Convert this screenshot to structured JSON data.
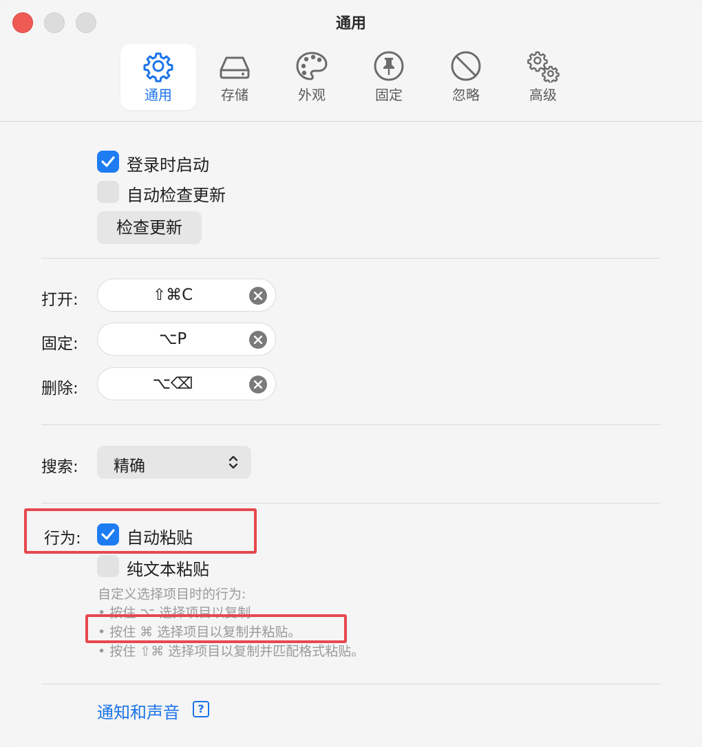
{
  "window": {
    "title": "通用"
  },
  "toolbar": {
    "tabs": [
      {
        "label": "通用",
        "icon": "gear-icon",
        "active": true
      },
      {
        "label": "存储",
        "icon": "storage-drive-icon",
        "active": false
      },
      {
        "label": "外观",
        "icon": "palette-icon",
        "active": false
      },
      {
        "label": "固定",
        "icon": "pin-icon",
        "active": false
      },
      {
        "label": "忽略",
        "icon": "prohibited-icon",
        "active": false
      },
      {
        "label": "高级",
        "icon": "gears-icon",
        "active": false
      }
    ]
  },
  "general": {
    "launch_at_login": {
      "label": "登录时启动",
      "checked": true
    },
    "auto_check_updates": {
      "label": "自动检查更新",
      "checked": false
    },
    "check_updates_button": "检查更新"
  },
  "shortcuts": {
    "open": {
      "label": "打开:",
      "keys": "⇧⌘C"
    },
    "pin": {
      "label": "固定:",
      "keys": "⌥P"
    },
    "delete": {
      "label": "删除:",
      "keys": "⌥⌫"
    }
  },
  "search": {
    "label": "搜索:",
    "value": "精确"
  },
  "behavior": {
    "label": "行为:",
    "auto_paste": {
      "label": "自动粘贴",
      "checked": true
    },
    "plain_text_paste": {
      "label": "纯文本粘贴",
      "checked": false
    },
    "hint_title": "自定义选择项目时的行为:",
    "hints": [
      "• 按住 ⌥ 选择项目以复制",
      "• 按住 ⌘ 选择项目以复制并粘贴。",
      "• 按住 ⇧⌘ 选择项目以复制并匹配格式粘贴。"
    ]
  },
  "footer": {
    "link": "通知和声音",
    "help": "?"
  },
  "colors": {
    "accent": "#1a73e8",
    "checkbox_checked": "#1e7cf2",
    "highlight": "#e6484f",
    "close_button": "#ef5a55"
  }
}
